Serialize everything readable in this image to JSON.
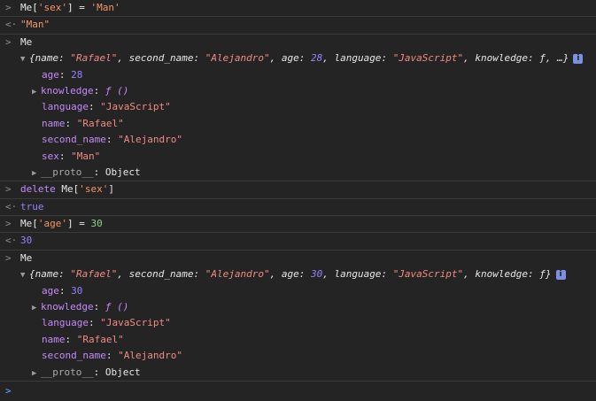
{
  "glyphs": {
    "input": ">",
    "output": "<·",
    "prompt": ">",
    "expand_down": "▼",
    "expand_right": "▶",
    "info": "i"
  },
  "log": [
    {
      "type": "input",
      "segments": [
        {
          "t": "Me[",
          "c": "k-white"
        },
        {
          "t": "'sex'",
          "c": "k-orange"
        },
        {
          "t": "] = ",
          "c": "k-white"
        },
        {
          "t": "'Man'",
          "c": "k-orange"
        }
      ]
    },
    {
      "type": "output",
      "segments": [
        {
          "t": "\"Man\"",
          "c": "k-orange"
        }
      ]
    },
    {
      "type": "input",
      "segments": [
        {
          "t": "Me",
          "c": "k-white"
        }
      ]
    },
    {
      "type": "object",
      "segments": [
        {
          "t": "{",
          "c": "k-white k-italic"
        },
        {
          "t": "name",
          "c": "k-white k-italic"
        },
        {
          "t": ": ",
          "c": "k-white k-italic"
        },
        {
          "t": "\"Rafael\"",
          "c": "k-str k-italic"
        },
        {
          "t": ", ",
          "c": "k-white k-italic"
        },
        {
          "t": "second_name",
          "c": "k-white k-italic"
        },
        {
          "t": ": ",
          "c": "k-white k-italic"
        },
        {
          "t": "\"Alejandro\"",
          "c": "k-str k-italic"
        },
        {
          "t": ", ",
          "c": "k-white k-italic"
        },
        {
          "t": "age",
          "c": "k-white k-italic"
        },
        {
          "t": ": ",
          "c": "k-white k-italic"
        },
        {
          "t": "28",
          "c": "k-num k-italic"
        },
        {
          "t": ", ",
          "c": "k-white k-italic"
        },
        {
          "t": "language",
          "c": "k-white k-italic"
        },
        {
          "t": ": ",
          "c": "k-white k-italic"
        },
        {
          "t": "\"JavaScript\"",
          "c": "k-str k-italic"
        },
        {
          "t": ", ",
          "c": "k-white k-italic"
        },
        {
          "t": "knowledge",
          "c": "k-white k-italic"
        },
        {
          "t": ": ",
          "c": "k-white k-italic"
        },
        {
          "t": "ƒ",
          "c": "k-white k-italic"
        },
        {
          "t": ", …}",
          "c": "k-white k-italic"
        }
      ],
      "props": [
        {
          "exp": false,
          "key": "age",
          "val": "28",
          "vc": "k-num"
        },
        {
          "exp": true,
          "key": "knowledge",
          "val": "ƒ ()",
          "vc": "fn"
        },
        {
          "exp": false,
          "key": "language",
          "val": "\"JavaScript\"",
          "vc": "k-str"
        },
        {
          "exp": false,
          "key": "name",
          "val": "\"Rafael\"",
          "vc": "k-str"
        },
        {
          "exp": false,
          "key": "second_name",
          "val": "\"Alejandro\"",
          "vc": "k-str"
        },
        {
          "exp": false,
          "key": "sex",
          "val": "\"Man\"",
          "vc": "k-str"
        },
        {
          "exp": true,
          "key": "__proto__",
          "val": "Object",
          "vc": "k-white",
          "proto": true
        }
      ]
    },
    {
      "type": "input",
      "segments": [
        {
          "t": "delete ",
          "c": "k-purple"
        },
        {
          "t": "Me[",
          "c": "k-white"
        },
        {
          "t": "'sex'",
          "c": "k-orange"
        },
        {
          "t": "]",
          "c": "k-white"
        }
      ]
    },
    {
      "type": "output",
      "segments": [
        {
          "t": "true",
          "c": "k-num"
        }
      ]
    },
    {
      "type": "input",
      "segments": [
        {
          "t": "Me[",
          "c": "k-white"
        },
        {
          "t": "'age'",
          "c": "k-orange"
        },
        {
          "t": "] = ",
          "c": "k-white"
        },
        {
          "t": "30",
          "c": "k-green"
        }
      ]
    },
    {
      "type": "output",
      "segments": [
        {
          "t": "30",
          "c": "k-num"
        }
      ]
    },
    {
      "type": "input",
      "segments": [
        {
          "t": "Me",
          "c": "k-white"
        }
      ]
    },
    {
      "type": "object",
      "segments": [
        {
          "t": "{",
          "c": "k-white k-italic"
        },
        {
          "t": "name",
          "c": "k-white k-italic"
        },
        {
          "t": ": ",
          "c": "k-white k-italic"
        },
        {
          "t": "\"Rafael\"",
          "c": "k-str k-italic"
        },
        {
          "t": ", ",
          "c": "k-white k-italic"
        },
        {
          "t": "second_name",
          "c": "k-white k-italic"
        },
        {
          "t": ": ",
          "c": "k-white k-italic"
        },
        {
          "t": "\"Alejandro\"",
          "c": "k-str k-italic"
        },
        {
          "t": ", ",
          "c": "k-white k-italic"
        },
        {
          "t": "age",
          "c": "k-white k-italic"
        },
        {
          "t": ": ",
          "c": "k-white k-italic"
        },
        {
          "t": "30",
          "c": "k-num k-italic"
        },
        {
          "t": ", ",
          "c": "k-white k-italic"
        },
        {
          "t": "language",
          "c": "k-white k-italic"
        },
        {
          "t": ": ",
          "c": "k-white k-italic"
        },
        {
          "t": "\"JavaScript\"",
          "c": "k-str k-italic"
        },
        {
          "t": ", ",
          "c": "k-white k-italic"
        },
        {
          "t": "knowledge",
          "c": "k-white k-italic"
        },
        {
          "t": ": ",
          "c": "k-white k-italic"
        },
        {
          "t": "ƒ",
          "c": "k-white k-italic"
        },
        {
          "t": "}",
          "c": "k-white k-italic"
        }
      ],
      "props": [
        {
          "exp": false,
          "key": "age",
          "val": "30",
          "vc": "k-num"
        },
        {
          "exp": true,
          "key": "knowledge",
          "val": "ƒ ()",
          "vc": "fn"
        },
        {
          "exp": false,
          "key": "language",
          "val": "\"JavaScript\"",
          "vc": "k-str"
        },
        {
          "exp": false,
          "key": "name",
          "val": "\"Rafael\"",
          "vc": "k-str"
        },
        {
          "exp": false,
          "key": "second_name",
          "val": "\"Alejandro\"",
          "vc": "k-str"
        },
        {
          "exp": true,
          "key": "__proto__",
          "val": "Object",
          "vc": "k-white",
          "proto": true
        }
      ]
    }
  ],
  "colors": {
    "background": "#242424",
    "accent_blue": "#6ea8ff",
    "string_red": "#f28b82",
    "number_purple": "#9980ff",
    "keyword_purple": "#c58af9",
    "literal_orange": "#f29766"
  }
}
